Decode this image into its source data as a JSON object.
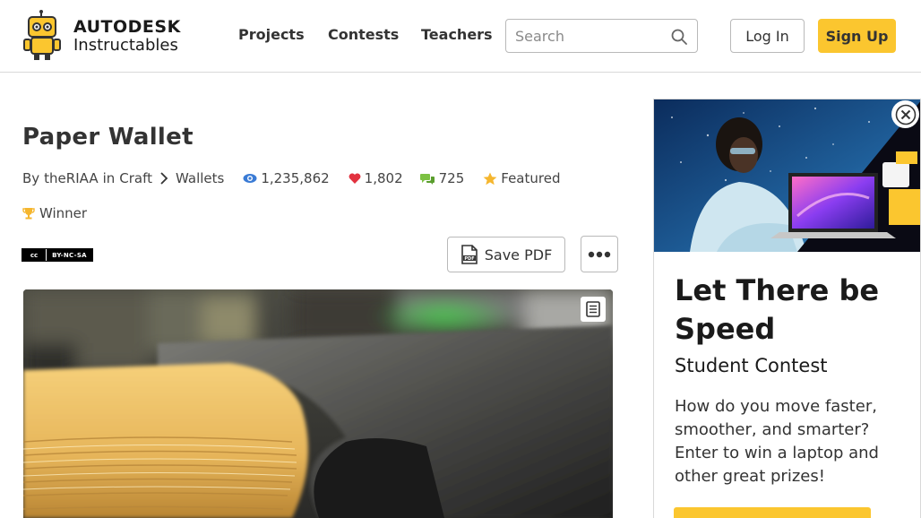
{
  "header": {
    "logo": {
      "brand_top": "AUTODESK",
      "brand_bottom": "Instructables",
      "icon": "instructables-robot-icon"
    },
    "nav": [
      {
        "label": "Projects"
      },
      {
        "label": "Contests"
      },
      {
        "label": "Teachers"
      }
    ],
    "search": {
      "placeholder": "Search",
      "value": "",
      "icon": "search-icon"
    },
    "login_label": "Log In",
    "signup_label": "Sign Up"
  },
  "article": {
    "title": "Paper Wallet",
    "by_prefix": "By",
    "author": "theRIAA",
    "in_word": "in",
    "category": "Craft",
    "subcategory": "Wallets",
    "views": "1,235,862",
    "favorites": "1,802",
    "comments": "725",
    "featured_label": "Featured",
    "winner_label": "Winner",
    "license_badge": {
      "left": "cc",
      "right": "BY-NC-SA"
    },
    "save_pdf_label": "Save PDF",
    "more_icon": "more-options-icon",
    "hero_alt_icon": "list-view-icon"
  },
  "ad": {
    "title": "Let There be Speed",
    "subtitle": "Student Contest",
    "text": "How do you move faster, smoother, and smarter? Enter to win a laptop and other great prizes!",
    "close_icon": "close-icon"
  },
  "colors": {
    "accent": "#fbc62f",
    "heart": "#e2323f",
    "eye": "#3a7bd5",
    "comment": "#7cc142",
    "star": "#f5b62e"
  }
}
